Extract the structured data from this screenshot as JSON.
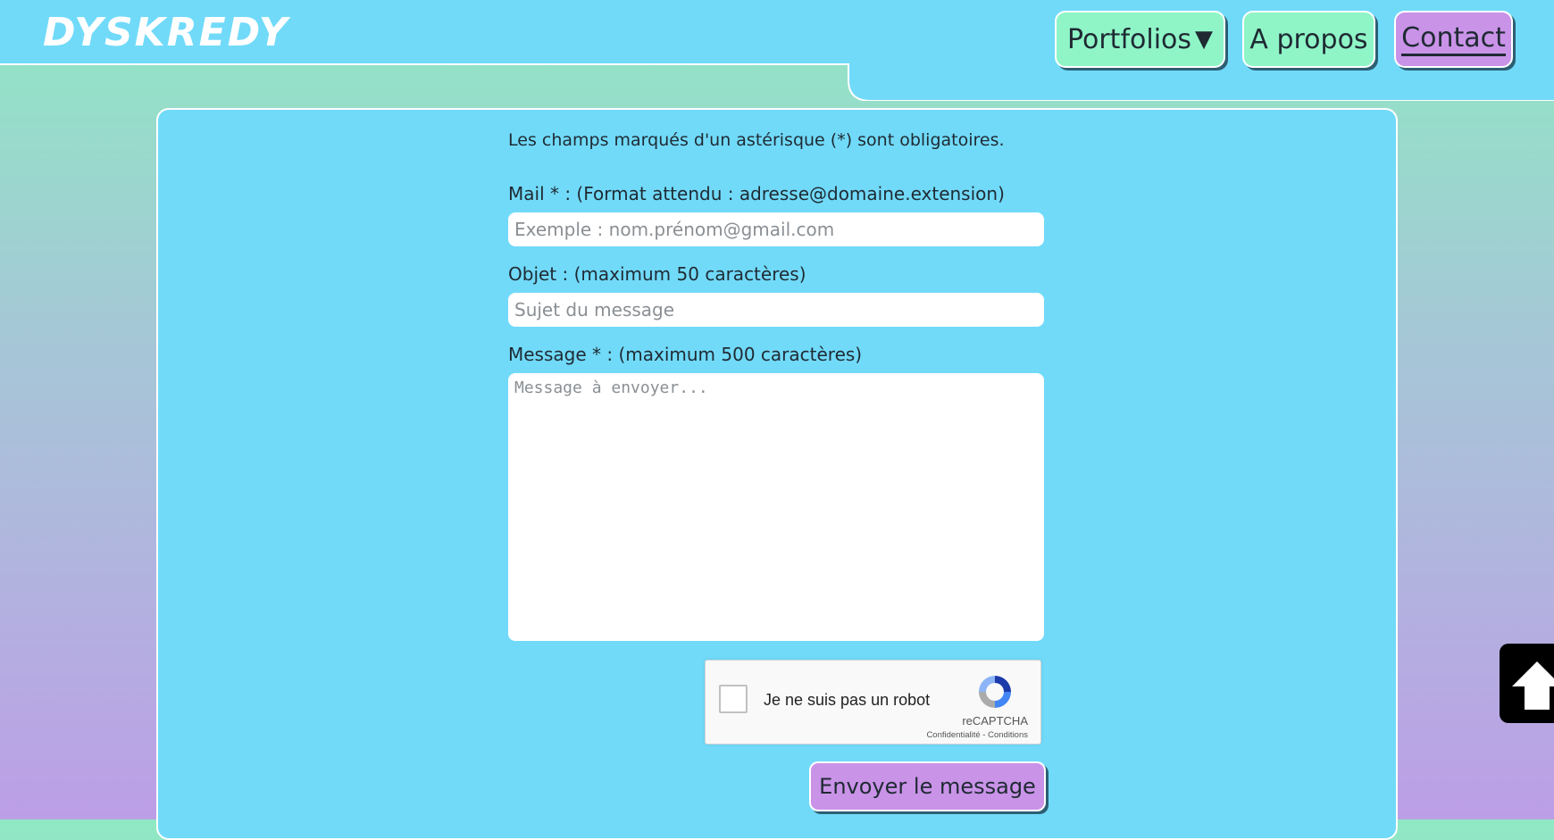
{
  "header": {
    "logo_text": "DYSKREDY",
    "nav": {
      "portfolios": "Portfolios",
      "portfolios_caret": "▼",
      "apropos": "A propos",
      "contact": "Contact"
    }
  },
  "form": {
    "required_note": "Les champs marqués d'un astérisque (*) sont obligatoires.",
    "mail_label": "Mail * : (Format attendu : adresse@domaine.extension)",
    "mail_placeholder": "Exemple : nom.prénom@gmail.com",
    "subject_label": "Objet : (maximum 50 caractères)",
    "subject_placeholder": "Sujet du message",
    "message_label": "Message * : (maximum 500 caractères)",
    "message_placeholder": "Message à envoyer...",
    "submit_label": "Envoyer le message"
  },
  "recaptcha": {
    "label": "Je ne suis pas un robot",
    "brand": "reCAPTCHA",
    "privacy": "Confidentialité",
    "separator": " - ",
    "terms": "Conditions"
  },
  "icons": {
    "back_to_top": "arrow-up-icon",
    "recaptcha_logo": "recaptcha-logo-icon"
  },
  "colors": {
    "panel": "#71daf9",
    "nav_green": "#8ff5c7",
    "nav_purple": "#c993e8",
    "text": "#1f2a33"
  }
}
